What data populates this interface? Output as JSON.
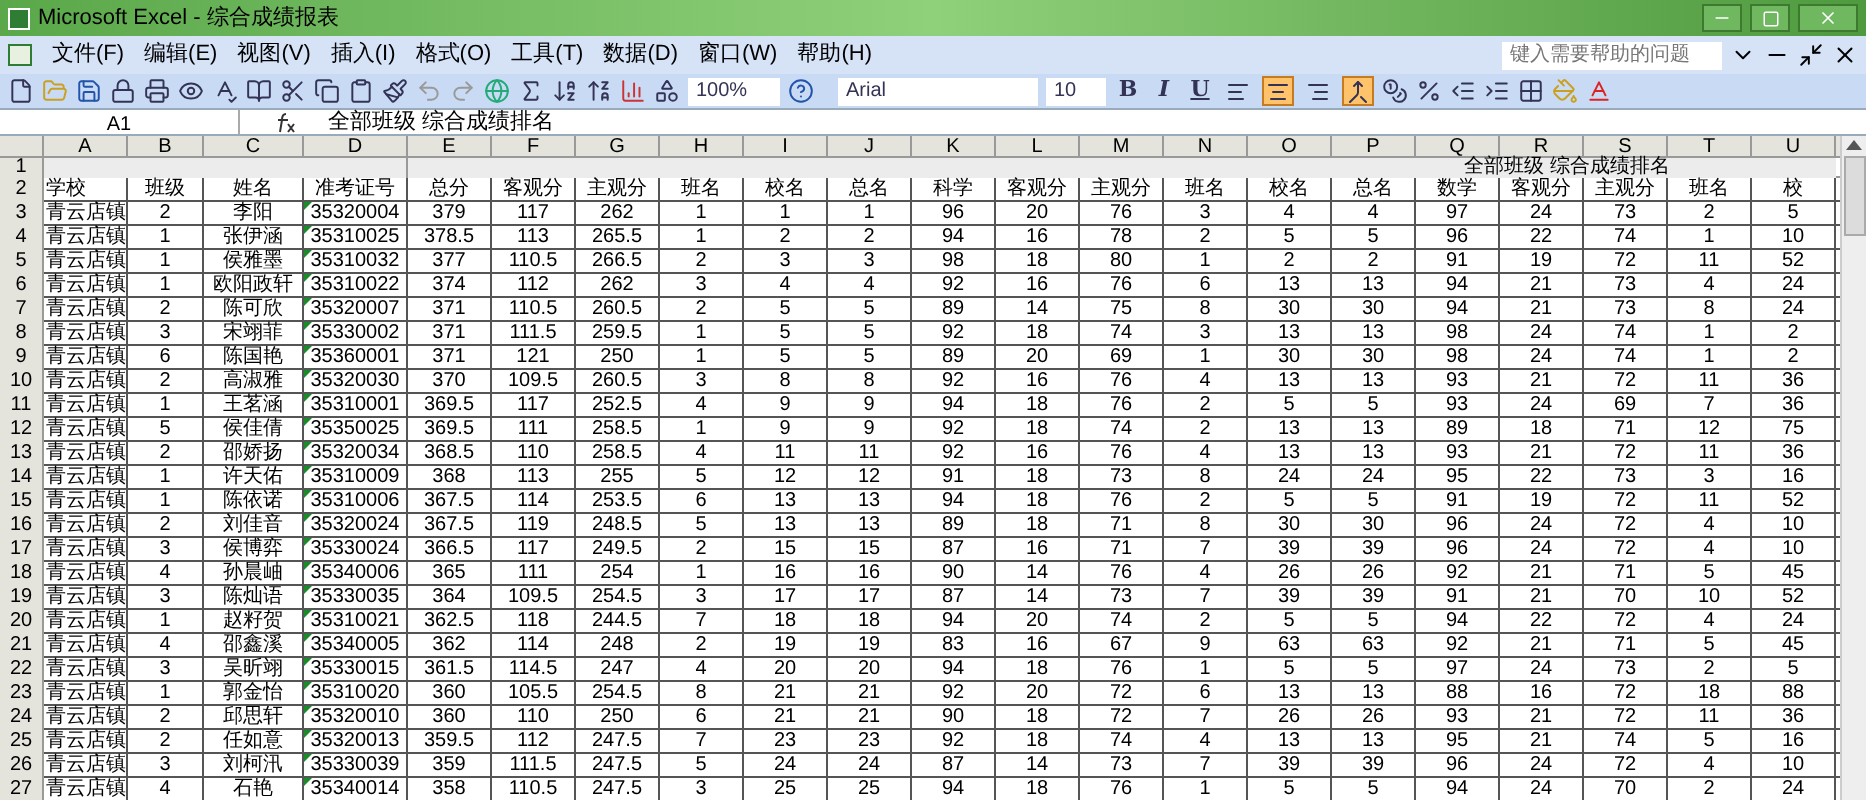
{
  "window": {
    "title": "Microsoft Excel - 综合成绩报表"
  },
  "menu": [
    "文件(F)",
    "编辑(E)",
    "视图(V)",
    "插入(I)",
    "格式(O)",
    "工具(T)",
    "数据(D)",
    "窗口(W)",
    "帮助(H)"
  ],
  "help_box": {
    "placeholder": "键入需要帮助的问题"
  },
  "toolbar": {
    "zoom": "100%",
    "font": "Arial",
    "font_size": "10",
    "text_buttons": [
      "B",
      "I",
      "U"
    ],
    "align_buttons": [
      {
        "kind": "left",
        "selected": false
      },
      {
        "kind": "center",
        "selected": true
      },
      {
        "kind": "right",
        "selected": false
      },
      {
        "kind": "merge",
        "selected": true
      }
    ]
  },
  "formula_bar": {
    "name_box": "A1",
    "content": "全部班级 综合成绩排名"
  },
  "sheet": {
    "columns": [
      "A",
      "B",
      "C",
      "D",
      "E",
      "F",
      "G",
      "H",
      "I",
      "J",
      "K",
      "L",
      "M",
      "N",
      "O",
      "P",
      "Q",
      "R",
      "S",
      "T",
      "U"
    ],
    "title_row": {
      "row": "1",
      "text": "全部班级 综合成绩排名"
    },
    "rows": [
      {
        "row": "2",
        "kind": "header",
        "cells": [
          "学校",
          "班级",
          "姓名",
          "准考证号",
          "总分",
          "客观分",
          "主观分",
          "班名",
          "校名",
          "总名",
          "科学",
          "客观分",
          "主观分",
          "班名",
          "校名",
          "总名",
          "数学",
          "客观分",
          "主观分",
          "班名",
          "校"
        ]
      },
      {
        "row": "3",
        "kind": "data",
        "cells": [
          "青云店镇",
          "2",
          "李阳",
          "35320004",
          "379",
          "117",
          "262",
          "1",
          "1",
          "1",
          "96",
          "20",
          "76",
          "3",
          "4",
          "4",
          "97",
          "24",
          "73",
          "2",
          "5"
        ]
      },
      {
        "row": "4",
        "kind": "data",
        "cells": [
          "青云店镇",
          "1",
          "张伊涵",
          "35310025",
          "378.5",
          "113",
          "265.5",
          "1",
          "2",
          "2",
          "94",
          "16",
          "78",
          "2",
          "5",
          "5",
          "96",
          "22",
          "74",
          "1",
          "10"
        ]
      },
      {
        "row": "5",
        "kind": "data",
        "cells": [
          "青云店镇",
          "1",
          "侯雅墨",
          "35310032",
          "377",
          "110.5",
          "266.5",
          "2",
          "3",
          "3",
          "98",
          "18",
          "80",
          "1",
          "2",
          "2",
          "91",
          "19",
          "72",
          "11",
          "52"
        ]
      },
      {
        "row": "6",
        "kind": "data",
        "cells": [
          "青云店镇",
          "1",
          "欧阳政轩",
          "35310022",
          "374",
          "112",
          "262",
          "3",
          "4",
          "4",
          "92",
          "16",
          "76",
          "6",
          "13",
          "13",
          "94",
          "21",
          "73",
          "4",
          "24"
        ]
      },
      {
        "row": "7",
        "kind": "data",
        "cells": [
          "青云店镇",
          "2",
          "陈可欣",
          "35320007",
          "371",
          "110.5",
          "260.5",
          "2",
          "5",
          "5",
          "89",
          "14",
          "75",
          "8",
          "30",
          "30",
          "94",
          "21",
          "73",
          "8",
          "24"
        ]
      },
      {
        "row": "8",
        "kind": "data",
        "cells": [
          "青云店镇",
          "3",
          "宋翊菲",
          "35330002",
          "371",
          "111.5",
          "259.5",
          "1",
          "5",
          "5",
          "92",
          "18",
          "74",
          "3",
          "13",
          "13",
          "98",
          "24",
          "74",
          "1",
          "2"
        ]
      },
      {
        "row": "9",
        "kind": "data",
        "cells": [
          "青云店镇",
          "6",
          "陈国艳",
          "35360001",
          "371",
          "121",
          "250",
          "1",
          "5",
          "5",
          "89",
          "20",
          "69",
          "1",
          "30",
          "30",
          "98",
          "24",
          "74",
          "1",
          "2"
        ]
      },
      {
        "row": "10",
        "kind": "data",
        "cells": [
          "青云店镇",
          "2",
          "高淑雅",
          "35320030",
          "370",
          "109.5",
          "260.5",
          "3",
          "8",
          "8",
          "92",
          "16",
          "76",
          "4",
          "13",
          "13",
          "93",
          "21",
          "72",
          "11",
          "36"
        ]
      },
      {
        "row": "11",
        "kind": "data",
        "cells": [
          "青云店镇",
          "1",
          "王茗涵",
          "35310001",
          "369.5",
          "117",
          "252.5",
          "4",
          "9",
          "9",
          "94",
          "18",
          "76",
          "2",
          "5",
          "5",
          "93",
          "24",
          "69",
          "7",
          "36"
        ]
      },
      {
        "row": "12",
        "kind": "data",
        "cells": [
          "青云店镇",
          "5",
          "侯佳倩",
          "35350025",
          "369.5",
          "111",
          "258.5",
          "1",
          "9",
          "9",
          "92",
          "18",
          "74",
          "2",
          "13",
          "13",
          "89",
          "18",
          "71",
          "12",
          "75"
        ]
      },
      {
        "row": "13",
        "kind": "data",
        "cells": [
          "青云店镇",
          "2",
          "邵娇扬",
          "35320034",
          "368.5",
          "110",
          "258.5",
          "4",
          "11",
          "11",
          "92",
          "16",
          "76",
          "4",
          "13",
          "13",
          "93",
          "21",
          "72",
          "11",
          "36"
        ]
      },
      {
        "row": "14",
        "kind": "data",
        "cells": [
          "青云店镇",
          "1",
          "许天佑",
          "35310009",
          "368",
          "113",
          "255",
          "5",
          "12",
          "12",
          "91",
          "18",
          "73",
          "8",
          "24",
          "24",
          "95",
          "22",
          "73",
          "3",
          "16"
        ]
      },
      {
        "row": "15",
        "kind": "data",
        "cells": [
          "青云店镇",
          "1",
          "陈依诺",
          "35310006",
          "367.5",
          "114",
          "253.5",
          "6",
          "13",
          "13",
          "94",
          "18",
          "76",
          "2",
          "5",
          "5",
          "91",
          "19",
          "72",
          "11",
          "52"
        ]
      },
      {
        "row": "16",
        "kind": "data",
        "cells": [
          "青云店镇",
          "2",
          "刘佳音",
          "35320024",
          "367.5",
          "119",
          "248.5",
          "5",
          "13",
          "13",
          "89",
          "18",
          "71",
          "8",
          "30",
          "30",
          "96",
          "24",
          "72",
          "4",
          "10"
        ]
      },
      {
        "row": "17",
        "kind": "data",
        "cells": [
          "青云店镇",
          "3",
          "侯博弈",
          "35330024",
          "366.5",
          "117",
          "249.5",
          "2",
          "15",
          "15",
          "87",
          "16",
          "71",
          "7",
          "39",
          "39",
          "96",
          "24",
          "72",
          "4",
          "10"
        ]
      },
      {
        "row": "18",
        "kind": "data",
        "cells": [
          "青云店镇",
          "4",
          "孙晨岫",
          "35340006",
          "365",
          "111",
          "254",
          "1",
          "16",
          "16",
          "90",
          "14",
          "76",
          "4",
          "26",
          "26",
          "92",
          "21",
          "71",
          "5",
          "45"
        ]
      },
      {
        "row": "19",
        "kind": "data",
        "cells": [
          "青云店镇",
          "3",
          "陈灿语",
          "35330035",
          "364",
          "109.5",
          "254.5",
          "3",
          "17",
          "17",
          "87",
          "14",
          "73",
          "7",
          "39",
          "39",
          "91",
          "21",
          "70",
          "10",
          "52"
        ]
      },
      {
        "row": "20",
        "kind": "data",
        "cells": [
          "青云店镇",
          "1",
          "赵籽贺",
          "35310021",
          "362.5",
          "118",
          "244.5",
          "7",
          "18",
          "18",
          "94",
          "20",
          "74",
          "2",
          "5",
          "5",
          "94",
          "22",
          "72",
          "4",
          "24"
        ]
      },
      {
        "row": "21",
        "kind": "data",
        "cells": [
          "青云店镇",
          "4",
          "邵鑫溪",
          "35340005",
          "362",
          "114",
          "248",
          "2",
          "19",
          "19",
          "83",
          "16",
          "67",
          "9",
          "63",
          "63",
          "92",
          "21",
          "71",
          "5",
          "45"
        ]
      },
      {
        "row": "22",
        "kind": "data",
        "cells": [
          "青云店镇",
          "3",
          "吴昕翊",
          "35330015",
          "361.5",
          "114.5",
          "247",
          "4",
          "20",
          "20",
          "94",
          "18",
          "76",
          "1",
          "5",
          "5",
          "97",
          "24",
          "73",
          "2",
          "5"
        ]
      },
      {
        "row": "23",
        "kind": "data",
        "cells": [
          "青云店镇",
          "1",
          "郭金怡",
          "35310020",
          "360",
          "105.5",
          "254.5",
          "8",
          "21",
          "21",
          "92",
          "20",
          "72",
          "6",
          "13",
          "13",
          "88",
          "16",
          "72",
          "18",
          "88"
        ]
      },
      {
        "row": "24",
        "kind": "data",
        "cells": [
          "青云店镇",
          "2",
          "邱思轩",
          "35320010",
          "360",
          "110",
          "250",
          "6",
          "21",
          "21",
          "90",
          "18",
          "72",
          "7",
          "26",
          "26",
          "93",
          "21",
          "72",
          "11",
          "36"
        ]
      },
      {
        "row": "25",
        "kind": "data",
        "cells": [
          "青云店镇",
          "2",
          "任如意",
          "35320013",
          "359.5",
          "112",
          "247.5",
          "7",
          "23",
          "23",
          "92",
          "18",
          "74",
          "4",
          "13",
          "13",
          "95",
          "21",
          "74",
          "5",
          "16"
        ]
      },
      {
        "row": "26",
        "kind": "data",
        "cells": [
          "青云店镇",
          "3",
          "刘柯汛",
          "35330039",
          "359",
          "111.5",
          "247.5",
          "5",
          "24",
          "24",
          "87",
          "14",
          "73",
          "7",
          "39",
          "39",
          "96",
          "24",
          "72",
          "4",
          "10"
        ]
      },
      {
        "row": "27",
        "kind": "data",
        "cells": [
          "青云店镇",
          "4",
          "石艳",
          "35340014",
          "358",
          "110.5",
          "247.5",
          "3",
          "25",
          "25",
          "94",
          "18",
          "76",
          "1",
          "5",
          "5",
          "94",
          "24",
          "70",
          "2",
          "24"
        ]
      }
    ]
  }
}
